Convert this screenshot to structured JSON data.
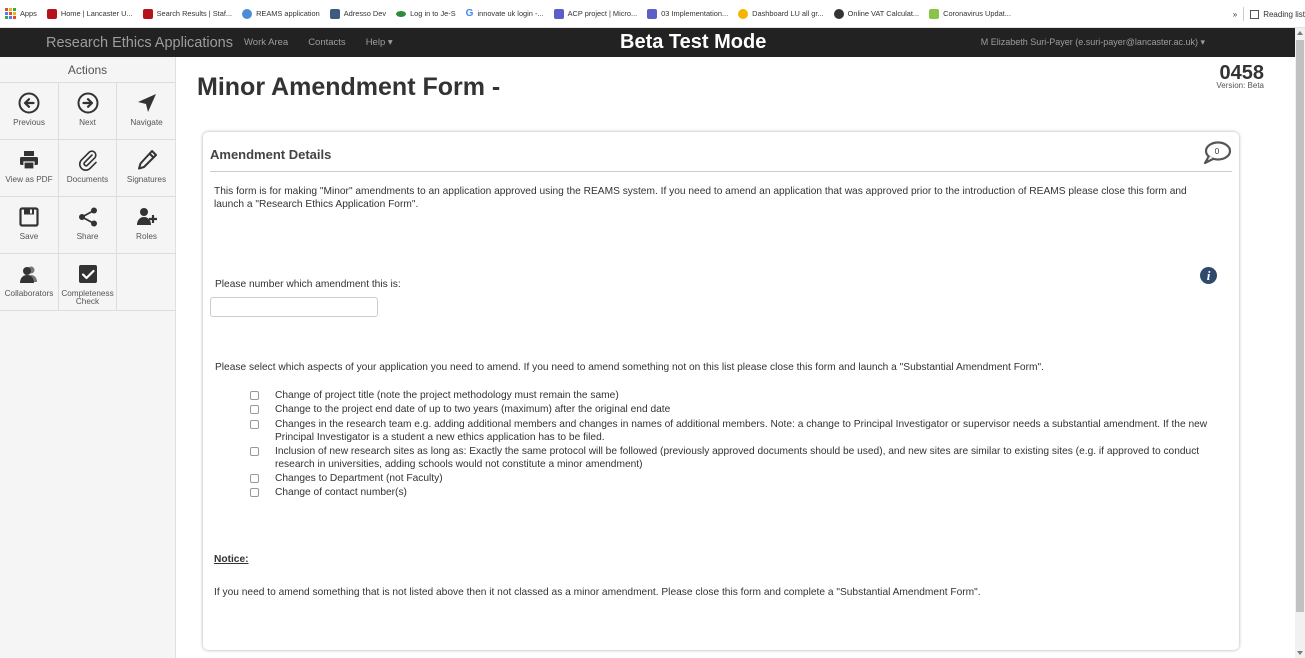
{
  "bookmarks": {
    "items": [
      {
        "label": "Apps",
        "color": "#e8453c"
      },
      {
        "label": "Home | Lancaster U...",
        "color": "#b5121b"
      },
      {
        "label": "Search Results | Staf...",
        "color": "#b5121b"
      },
      {
        "label": "REAMS application",
        "color": "#4a8cd6"
      },
      {
        "label": "Adresso Dev",
        "color": "#3d5a80"
      },
      {
        "label": "Log in to Je-S",
        "color": "#2e8b3a"
      },
      {
        "label": "innovate uk login -...",
        "color": "#4285f4"
      },
      {
        "label": "ACP project | Micro...",
        "color": "#5b5fc7"
      },
      {
        "label": "03 Implementation...",
        "color": "#5b5fc7"
      },
      {
        "label": "Dashboard LU all gr...",
        "color": "#f4b400"
      },
      {
        "label": "Online VAT Calculat...",
        "color": "#333333"
      },
      {
        "label": "Coronavirus Updat...",
        "color": "#8bc34a"
      }
    ],
    "more": "»",
    "reading_list": "Reading list"
  },
  "topnav": {
    "brand": "Research Ethics Applications",
    "links": [
      "Work Area",
      "Contacts",
      "Help ▾"
    ],
    "banner": "Beta Test Mode",
    "user": "M Elizabeth Suri-Payer (e.suri-payer@lancaster.ac.uk) ▾"
  },
  "sidebar": {
    "title": "Actions",
    "actions": [
      {
        "label": "Previous",
        "icon": "arrow-left-circle-icon"
      },
      {
        "label": "Next",
        "icon": "arrow-right-circle-icon"
      },
      {
        "label": "Navigate",
        "icon": "location-arrow-icon"
      },
      {
        "label": "View as PDF",
        "icon": "printer-icon"
      },
      {
        "label": "Documents",
        "icon": "paperclip-icon"
      },
      {
        "label": "Signatures",
        "icon": "pencil-icon"
      },
      {
        "label": "Save",
        "icon": "floppy-disk-icon"
      },
      {
        "label": "Share",
        "icon": "share-icon"
      },
      {
        "label": "Roles",
        "icon": "user-plus-icon"
      },
      {
        "label": "Collaborators",
        "icon": "users-icon"
      },
      {
        "label": "Completeness Check",
        "icon": "checkbox-icon"
      }
    ]
  },
  "page": {
    "title": "Minor Amendment Form -",
    "form_number": "0458",
    "version": "Version: Beta"
  },
  "panel": {
    "header": "Amendment Details",
    "comment_count": "0",
    "intro": "This form is for making \"Minor\" amendments to an application approved using the REAMS system. If you need to amend an application that was approved prior to the introduction of REAMS please close this form and launch a \"Research Ethics Application Form\".",
    "q_number": "Please number which amendment this is:",
    "q_number_value": "",
    "q_aspects": "Please select which aspects of your application you need to amend. If you need to amend something not on this list please close this form and launch a \"Substantial Amendment Form\".",
    "options": [
      "Change of project title (note the project methodology must remain the same)",
      "Change to the project end date of up to two years (maximum) after the original end date",
      "Changes in the research team e.g. adding additional members and changes in names of additional members. Note: a change to Principal Investigator or supervisor needs a substantial amendment. If the new Principal Investigator is a student a new ethics application has to be filed.",
      "Inclusion of new research sites as long as: Exactly the same protocol will be followed (previously approved documents should be used), and new sites are similar to existing sites (e.g. if approved to conduct research in universities, adding schools would not constitute a minor amendment)",
      "Changes to Department (not Faculty)",
      "Change of contact number(s)"
    ],
    "notice_heading": "Notice:",
    "notice_text": "If you need to amend something that is not listed above then it not classed as a minor amendment. Please close this form and complete a \"Substantial Amendment Form\"."
  }
}
